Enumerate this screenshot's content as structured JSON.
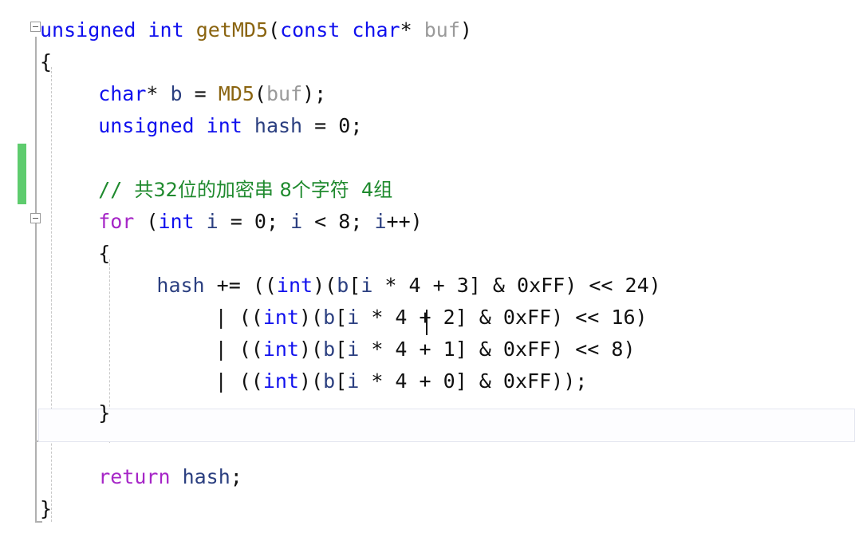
{
  "editor": {
    "language": "cpp",
    "background_color": "#ffffff",
    "font_size_px": 25,
    "line_height_px": 40
  },
  "gutter": {
    "change_bar": {
      "name": "unsaved-change-indicator",
      "color": "#5ECC6E"
    },
    "fold_markers": [
      {
        "label": "−",
        "target": "function-getMD5",
        "state": "expanded"
      },
      {
        "label": "−",
        "target": "for-loop",
        "state": "expanded"
      }
    ]
  },
  "caret": {
    "visible": true,
    "line_index": 9,
    "over_character": "4"
  },
  "current_line": {
    "line_index": 13,
    "text": "}"
  },
  "code": {
    "lines": [
      {
        "index": 1,
        "indent": 0,
        "tokens": [
          {
            "t": "unsigned",
            "c": "kw"
          },
          {
            "t": " ",
            "c": "punc"
          },
          {
            "t": "int",
            "c": "kw"
          },
          {
            "t": " ",
            "c": "punc"
          },
          {
            "t": "getMD5",
            "c": "fn"
          },
          {
            "t": "(",
            "c": "punc"
          },
          {
            "t": "const",
            "c": "kw"
          },
          {
            "t": " ",
            "c": "punc"
          },
          {
            "t": "char",
            "c": "kw"
          },
          {
            "t": "*",
            "c": "punc"
          },
          {
            "t": " ",
            "c": "punc"
          },
          {
            "t": "buf",
            "c": "param"
          },
          {
            "t": ")",
            "c": "punc"
          }
        ]
      },
      {
        "index": 2,
        "indent": 0,
        "tokens": [
          {
            "t": "{",
            "c": "punc"
          }
        ]
      },
      {
        "index": 3,
        "indent": 1,
        "tokens": [
          {
            "t": "char",
            "c": "kw"
          },
          {
            "t": "* ",
            "c": "punc"
          },
          {
            "t": "b",
            "c": "var"
          },
          {
            "t": " = ",
            "c": "punc"
          },
          {
            "t": "MD5",
            "c": "fn"
          },
          {
            "t": "(",
            "c": "punc"
          },
          {
            "t": "buf",
            "c": "param"
          },
          {
            "t": ");",
            "c": "punc"
          }
        ]
      },
      {
        "index": 4,
        "indent": 1,
        "tokens": [
          {
            "t": "unsigned",
            "c": "kw"
          },
          {
            "t": " ",
            "c": "punc"
          },
          {
            "t": "int",
            "c": "kw"
          },
          {
            "t": " ",
            "c": "punc"
          },
          {
            "t": "hash",
            "c": "var"
          },
          {
            "t": " = ",
            "c": "punc"
          },
          {
            "t": "0",
            "c": "num"
          },
          {
            "t": ";",
            "c": "punc"
          }
        ]
      },
      {
        "index": 5,
        "indent": 1,
        "tokens": []
      },
      {
        "index": 6,
        "indent": 1,
        "tokens": [
          {
            "t": "// ",
            "c": "cmt"
          },
          {
            "t": "共32位的加密串 8个字符  4组",
            "c": "cmt cmt-cn"
          }
        ]
      },
      {
        "index": 7,
        "indent": 1,
        "tokens": [
          {
            "t": "for",
            "c": "ctrl"
          },
          {
            "t": " (",
            "c": "punc"
          },
          {
            "t": "int",
            "c": "kw"
          },
          {
            "t": " ",
            "c": "punc"
          },
          {
            "t": "i",
            "c": "var"
          },
          {
            "t": " = ",
            "c": "punc"
          },
          {
            "t": "0",
            "c": "num"
          },
          {
            "t": "; ",
            "c": "punc"
          },
          {
            "t": "i",
            "c": "var"
          },
          {
            "t": " < ",
            "c": "punc"
          },
          {
            "t": "8",
            "c": "num"
          },
          {
            "t": "; ",
            "c": "punc"
          },
          {
            "t": "i",
            "c": "var"
          },
          {
            "t": "++)",
            "c": "punc"
          }
        ]
      },
      {
        "index": 8,
        "indent": 1,
        "tokens": [
          {
            "t": "{",
            "c": "punc"
          }
        ]
      },
      {
        "index": 9,
        "indent": 2,
        "tokens": [
          {
            "t": "hash",
            "c": "var"
          },
          {
            "t": " += ((",
            "c": "punc"
          },
          {
            "t": "int",
            "c": "kw"
          },
          {
            "t": ")(",
            "c": "punc"
          },
          {
            "t": "b",
            "c": "var"
          },
          {
            "t": "[",
            "c": "punc"
          },
          {
            "t": "i",
            "c": "var"
          },
          {
            "t": " * ",
            "c": "punc"
          },
          {
            "t": "4",
            "c": "num"
          },
          {
            "t": " + ",
            "c": "punc"
          },
          {
            "t": "3",
            "c": "num"
          },
          {
            "t": "] & ",
            "c": "punc"
          },
          {
            "t": "0xFF",
            "c": "num"
          },
          {
            "t": ") << ",
            "c": "punc"
          },
          {
            "t": "24",
            "c": "num"
          },
          {
            "t": ")",
            "c": "punc"
          }
        ]
      },
      {
        "index": 10,
        "indent": 3,
        "tokens": [
          {
            "t": "| ((",
            "c": "punc"
          },
          {
            "t": "int",
            "c": "kw"
          },
          {
            "t": ")(",
            "c": "punc"
          },
          {
            "t": "b",
            "c": "var"
          },
          {
            "t": "[",
            "c": "punc"
          },
          {
            "t": "i",
            "c": "var"
          },
          {
            "t": " * ",
            "c": "punc"
          },
          {
            "t": "4",
            "c": "num"
          },
          {
            "t": " + ",
            "c": "punc"
          },
          {
            "t": "2",
            "c": "num"
          },
          {
            "t": "] & ",
            "c": "punc"
          },
          {
            "t": "0xFF",
            "c": "num"
          },
          {
            "t": ") << ",
            "c": "punc"
          },
          {
            "t": "16",
            "c": "num"
          },
          {
            "t": ")",
            "c": "punc"
          }
        ]
      },
      {
        "index": 11,
        "indent": 3,
        "tokens": [
          {
            "t": "| ((",
            "c": "punc"
          },
          {
            "t": "int",
            "c": "kw"
          },
          {
            "t": ")(",
            "c": "punc"
          },
          {
            "t": "b",
            "c": "var"
          },
          {
            "t": "[",
            "c": "punc"
          },
          {
            "t": "i",
            "c": "var"
          },
          {
            "t": " * ",
            "c": "punc"
          },
          {
            "t": "4",
            "c": "num"
          },
          {
            "t": " + ",
            "c": "punc"
          },
          {
            "t": "1",
            "c": "num"
          },
          {
            "t": "] & ",
            "c": "punc"
          },
          {
            "t": "0xFF",
            "c": "num"
          },
          {
            "t": ") << ",
            "c": "punc"
          },
          {
            "t": "8",
            "c": "num"
          },
          {
            "t": ")",
            "c": "punc"
          }
        ]
      },
      {
        "index": 12,
        "indent": 3,
        "tokens": [
          {
            "t": "| ((",
            "c": "punc"
          },
          {
            "t": "int",
            "c": "kw"
          },
          {
            "t": ")(",
            "c": "punc"
          },
          {
            "t": "b",
            "c": "var"
          },
          {
            "t": "[",
            "c": "punc"
          },
          {
            "t": "i",
            "c": "var"
          },
          {
            "t": " * ",
            "c": "punc"
          },
          {
            "t": "4",
            "c": "num"
          },
          {
            "t": " + ",
            "c": "punc"
          },
          {
            "t": "0",
            "c": "num"
          },
          {
            "t": "] & ",
            "c": "punc"
          },
          {
            "t": "0xFF",
            "c": "num"
          },
          {
            "t": "));",
            "c": "punc"
          }
        ]
      },
      {
        "index": 13,
        "indent": 1,
        "tokens": [
          {
            "t": "}",
            "c": "punc"
          }
        ]
      },
      {
        "index": 14,
        "indent": 1,
        "tokens": []
      },
      {
        "index": 15,
        "indent": 1,
        "tokens": [
          {
            "t": "return",
            "c": "ctrl"
          },
          {
            "t": " ",
            "c": "punc"
          },
          {
            "t": "hash",
            "c": "var"
          },
          {
            "t": ";",
            "c": "punc"
          }
        ]
      },
      {
        "index": 16,
        "indent": 0,
        "tokens": [
          {
            "t": "}",
            "c": "punc"
          }
        ]
      }
    ]
  }
}
